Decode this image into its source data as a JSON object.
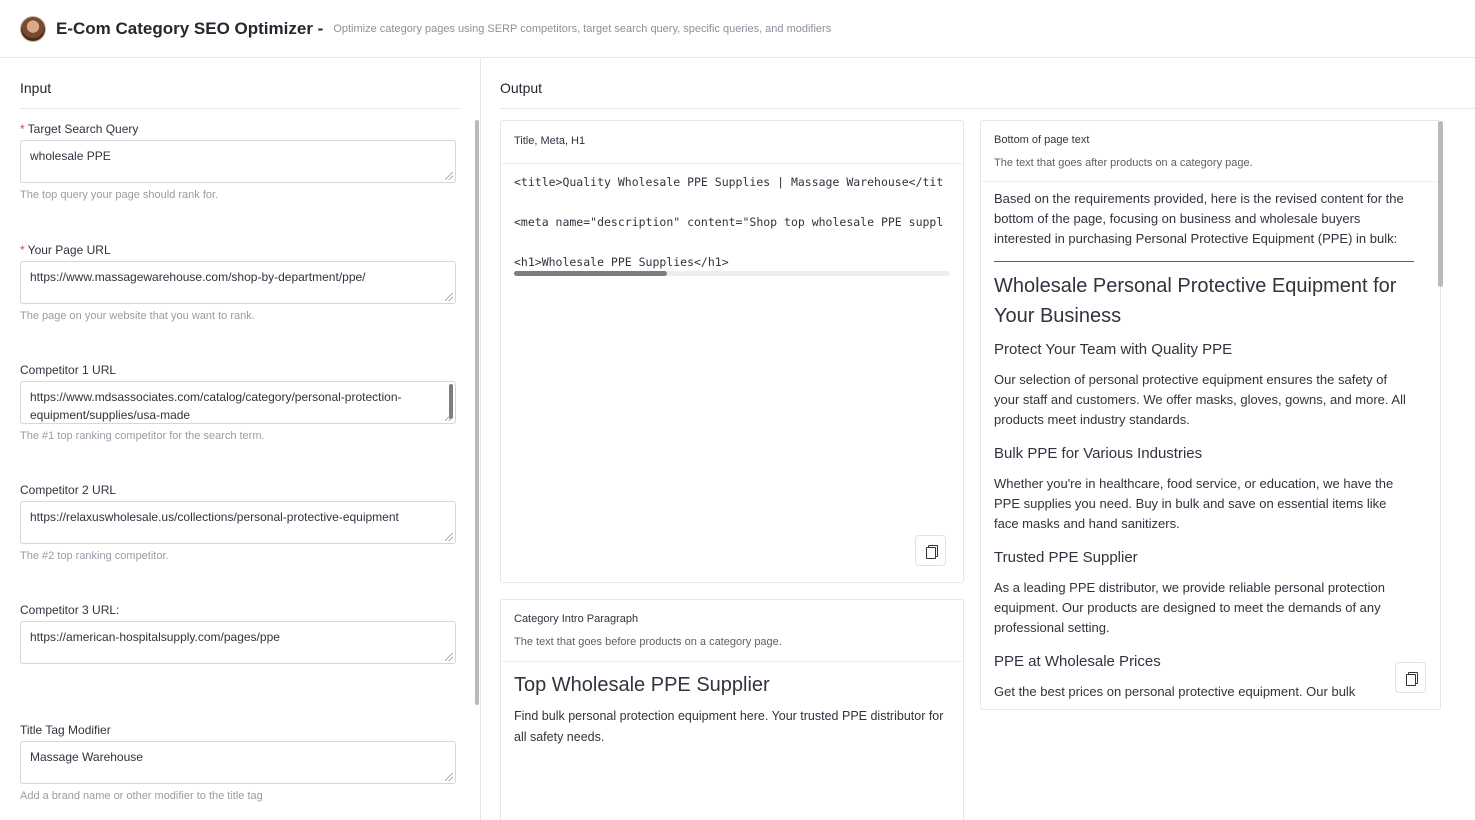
{
  "header": {
    "title": "E-Com Category SEO Optimizer -",
    "subtitle": "Optimize category pages using SERP competitors, target search query, specific queries, and modifiers"
  },
  "input": {
    "section_title": "Input",
    "fields": [
      {
        "label": "Target Search Query",
        "required": "*",
        "value": "wholesale PPE",
        "help": "The top query your page should rank for."
      },
      {
        "label": "Your Page URL",
        "required": "*",
        "value": "https://www.massagewarehouse.com/shop-by-department/ppe/",
        "help": "The page on your website that you want to rank."
      },
      {
        "label": "Competitor 1 URL",
        "value": "https://www.mdsassociates.com/catalog/category/personal-protection-equipment/supplies/usa-made",
        "help": "The #1 top ranking competitor for the search term."
      },
      {
        "label": "Competitor 2 URL",
        "value": "https://relaxuswholesale.us/collections/personal-protective-equipment",
        "help": "The #2 top ranking competitor."
      },
      {
        "label": "Competitor 3 URL:",
        "value": "https://american-hospitalsupply.com/pages/ppe",
        "help": ""
      },
      {
        "label": "Title Tag Modifier",
        "value": "Massage Warehouse",
        "help": "Add a brand name or other modifier to the title tag"
      }
    ]
  },
  "output": {
    "section_title": "Output",
    "title_meta": {
      "label": "Title, Meta, H1",
      "lines": [
        "<title>Quality Wholesale PPE Supplies | Massage Warehouse</tit",
        "<meta name=\"description\" content=\"Shop top wholesale PPE suppl",
        "<h1>Wholesale PPE Supplies</h1>"
      ],
      "scroll_fraction": 0.35
    },
    "intro": {
      "label": "Category Intro Paragraph",
      "desc": "The text that goes before products on a category page.",
      "heading": "Top Wholesale PPE Supplier",
      "body": "Find bulk personal protection equipment here. Your trusted PPE distributor for all safety needs."
    },
    "bottom": {
      "label": "Bottom of page text",
      "desc": "The text that goes after products on a category page.",
      "intro": "Based on the requirements provided, here is the revised content for the bottom of the page, focusing on business and wholesale buyers interested in purchasing Personal Protective Equipment (PPE) in bulk:",
      "h2": "Wholesale Personal Protective Equipment for Your Business",
      "sections": [
        {
          "h3": "Protect Your Team with Quality PPE",
          "p": "Our selection of personal protective equipment ensures the safety of your staff and customers. We offer masks, gloves, gowns, and more. All products meet industry standards."
        },
        {
          "h3": "Bulk PPE for Various Industries",
          "p": "Whether you're in healthcare, food service, or education, we have the PPE supplies you need. Buy in bulk and save on essential items like face masks and hand sanitizers."
        },
        {
          "h3": "Trusted PPE Supplier",
          "p": "As a leading PPE distributor, we provide reliable personal protection equipment. Our products are designed to meet the demands of any professional setting."
        },
        {
          "h3": "PPE at Wholesale Prices",
          "p": "Get the best prices on personal protective equipment. Our bulk"
        }
      ]
    }
  },
  "icons": {
    "copy": "copy-icon",
    "resize": "resize-handle-icon"
  }
}
